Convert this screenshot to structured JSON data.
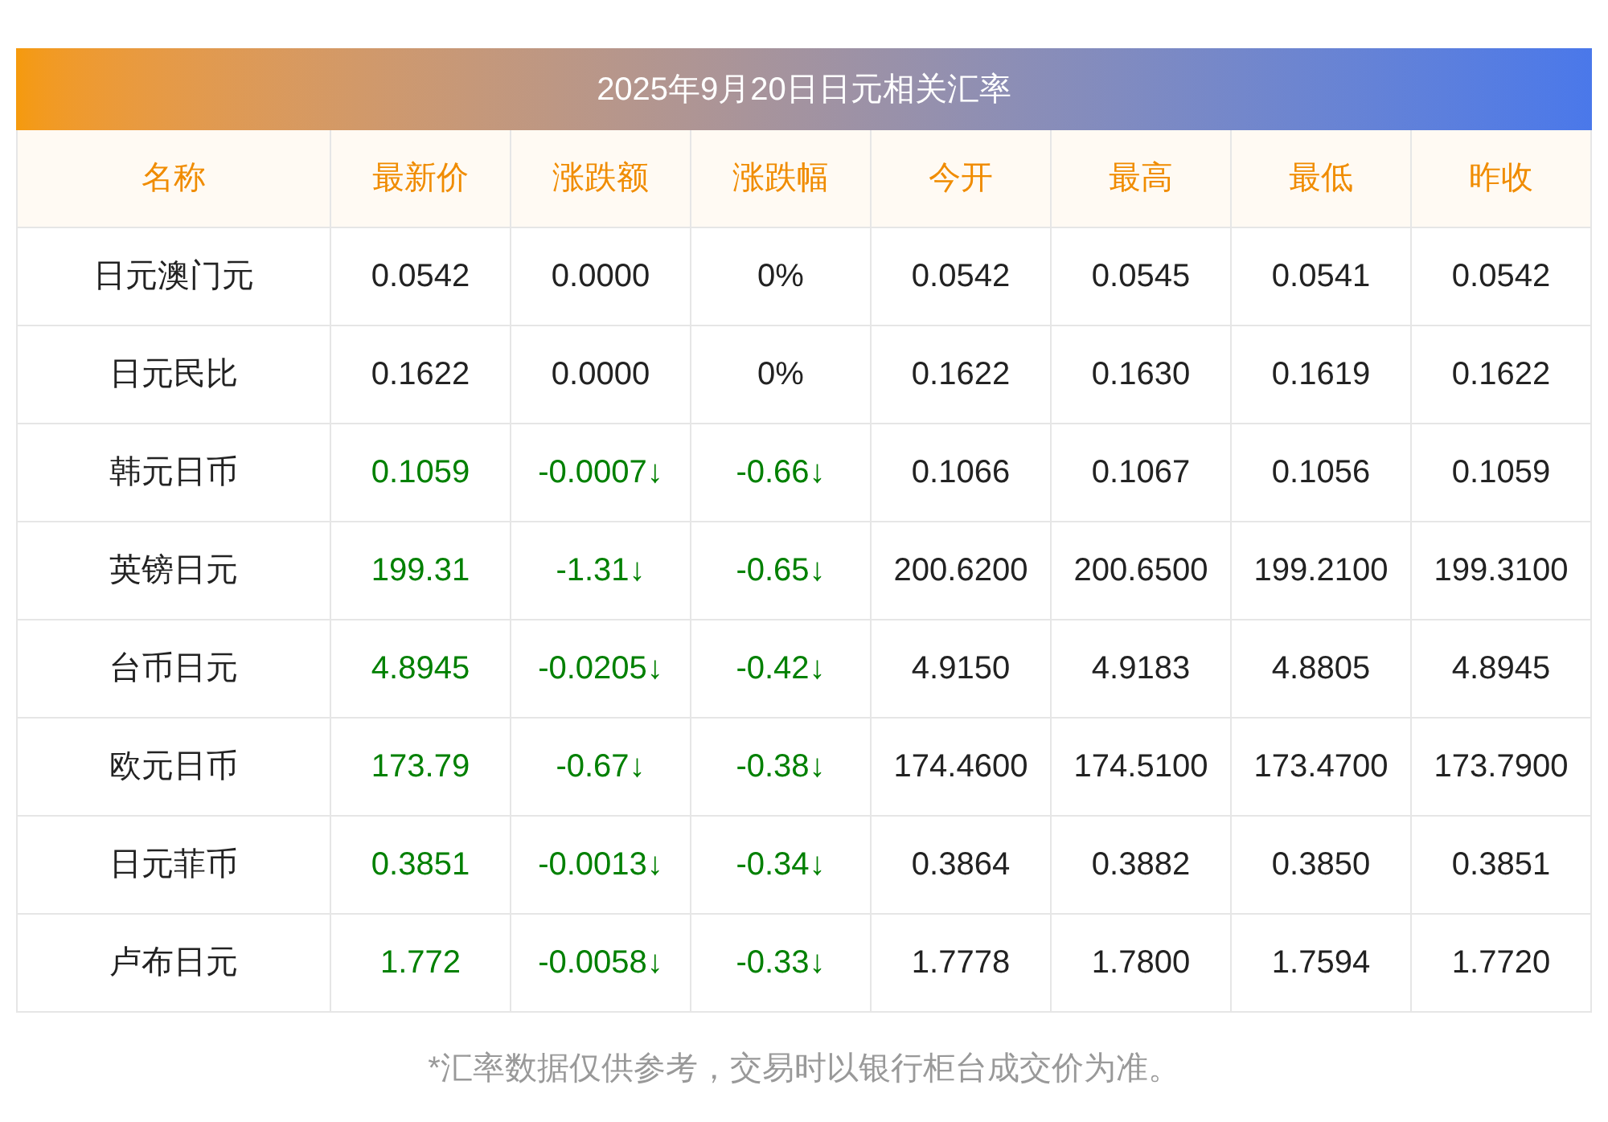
{
  "title": "2025年9月20日日元相关汇率",
  "columns": [
    "名称",
    "最新价",
    "涨跌额",
    "涨跌幅",
    "今开",
    "最高",
    "最低",
    "昨收"
  ],
  "rows": [
    {
      "name": "日元澳门元",
      "falling": false,
      "cells": [
        "0.0542",
        "0.0000",
        "0%",
        "0.0542",
        "0.0545",
        "0.0541",
        "0.0542"
      ]
    },
    {
      "name": "日元民比",
      "falling": false,
      "cells": [
        "0.1622",
        "0.0000",
        "0%",
        "0.1622",
        "0.1630",
        "0.1619",
        "0.1622"
      ]
    },
    {
      "name": "韩元日币",
      "falling": true,
      "cells": [
        "0.1059",
        "-0.0007↓",
        "-0.66↓",
        "0.1066",
        "0.1067",
        "0.1056",
        "0.1059"
      ]
    },
    {
      "name": "英镑日元",
      "falling": true,
      "cells": [
        "199.31",
        "-1.31↓",
        "-0.65↓",
        "200.6200",
        "200.6500",
        "199.2100",
        "199.3100"
      ]
    },
    {
      "name": "台币日元",
      "falling": true,
      "cells": [
        "4.8945",
        "-0.0205↓",
        "-0.42↓",
        "4.9150",
        "4.9183",
        "4.8805",
        "4.8945"
      ]
    },
    {
      "name": "欧元日币",
      "falling": true,
      "cells": [
        "173.79",
        "-0.67↓",
        "-0.38↓",
        "174.4600",
        "174.5100",
        "173.4700",
        "173.7900"
      ]
    },
    {
      "name": "日元菲币",
      "falling": true,
      "cells": [
        "0.3851",
        "-0.0013↓",
        "-0.34↓",
        "0.3864",
        "0.3882",
        "0.3850",
        "0.3851"
      ]
    },
    {
      "name": "卢布日元",
      "falling": true,
      "cells": [
        "1.772",
        "-0.0058↓",
        "-0.33↓",
        "1.7778",
        "1.7800",
        "1.7594",
        "1.7720"
      ]
    }
  ],
  "footnote": "*汇率数据仅供参考，交易时以银行柜台成交价为准。"
}
